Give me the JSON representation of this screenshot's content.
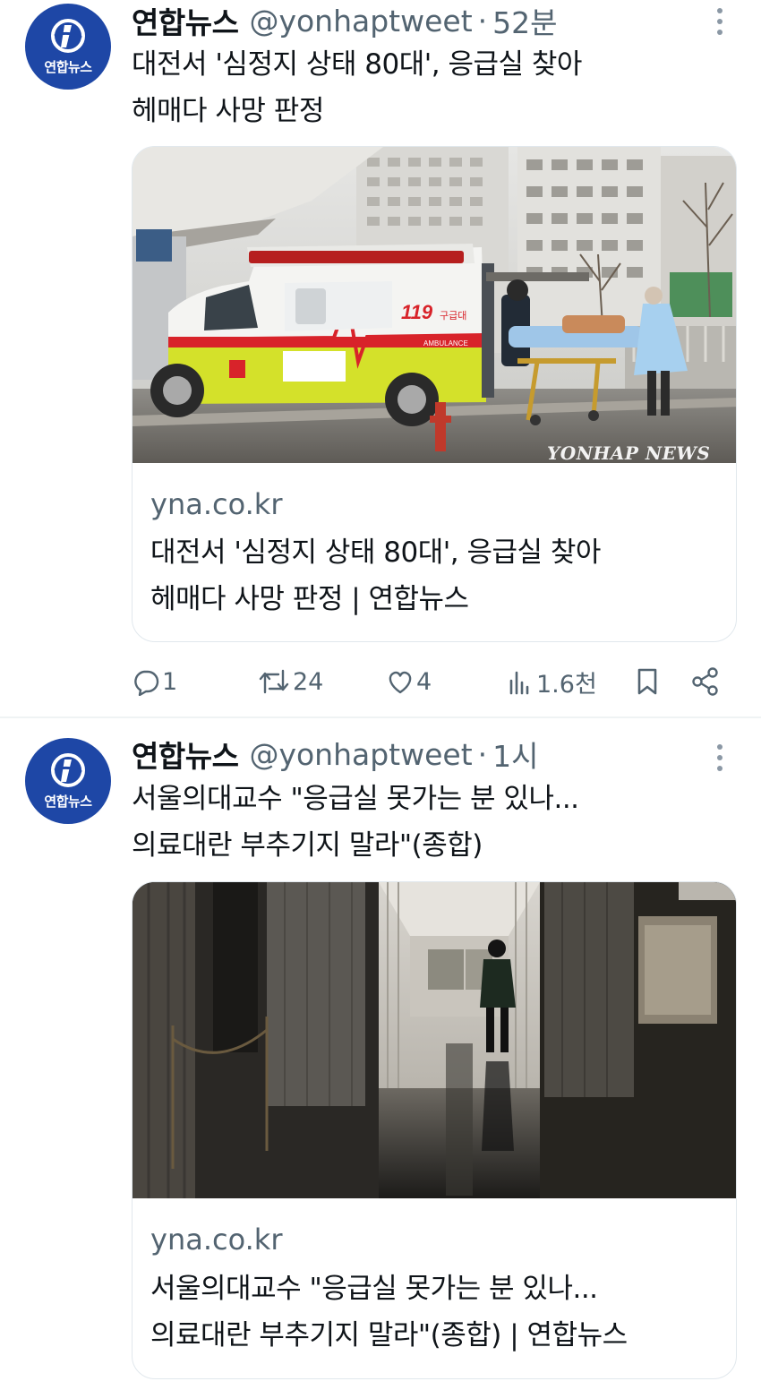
{
  "tweets": [
    {
      "author": "연합뉴스",
      "handle": "@yonhaptweet",
      "separator": "·",
      "time": "52분",
      "avatar_text": "연합뉴스",
      "text_line1": "대전서 '심정지 상태 80대', 응급실 찾아",
      "text_line2": "헤매다 사망 판정",
      "card": {
        "domain": "yna.co.kr",
        "title_line1": "대전서 '심정지 상태 80대', 응급실 찾아",
        "title_line2": "헤매다 사망 판정 | 연합뉴스",
        "image_watermark": "YONHAP NEWS",
        "image_labels": {
          "unit_number": "119",
          "unit_name": "구급대",
          "ambulance": "AMBULANCE"
        }
      },
      "stats": {
        "replies": "1",
        "retweets": "24",
        "likes": "4",
        "views": "1.6천"
      }
    },
    {
      "author": "연합뉴스",
      "handle": "@yonhaptweet",
      "separator": "·",
      "time": "1시",
      "avatar_text": "연합뉴스",
      "text_line1": "서울의대교수 \"응급실 못가는 분 있나...",
      "text_line2": "의료대란 부추기지 말라\"(종합)",
      "card": {
        "domain": "yna.co.kr",
        "title_line1": "서울의대교수 \"응급실 못가는 분 있나...",
        "title_line2": "의료대란 부추기지 말라\"(종합) | 연합뉴스"
      }
    }
  ],
  "icons": {
    "reply": "speech-bubble-icon",
    "retweet": "retweet-arrows-icon",
    "like": "heart-icon",
    "views": "bar-chart-icon",
    "bookmark": "bookmark-icon",
    "share": "share-nodes-icon",
    "more": "vertical-ellipsis-icon"
  },
  "colors": {
    "text_primary": "#0f1419",
    "text_secondary": "#536471",
    "avatar_bg": "#1e47a6",
    "ambulance_yellow": "#d4e12a",
    "ambulance_red": "#d8232a",
    "card_border": "#e1e8ed"
  }
}
